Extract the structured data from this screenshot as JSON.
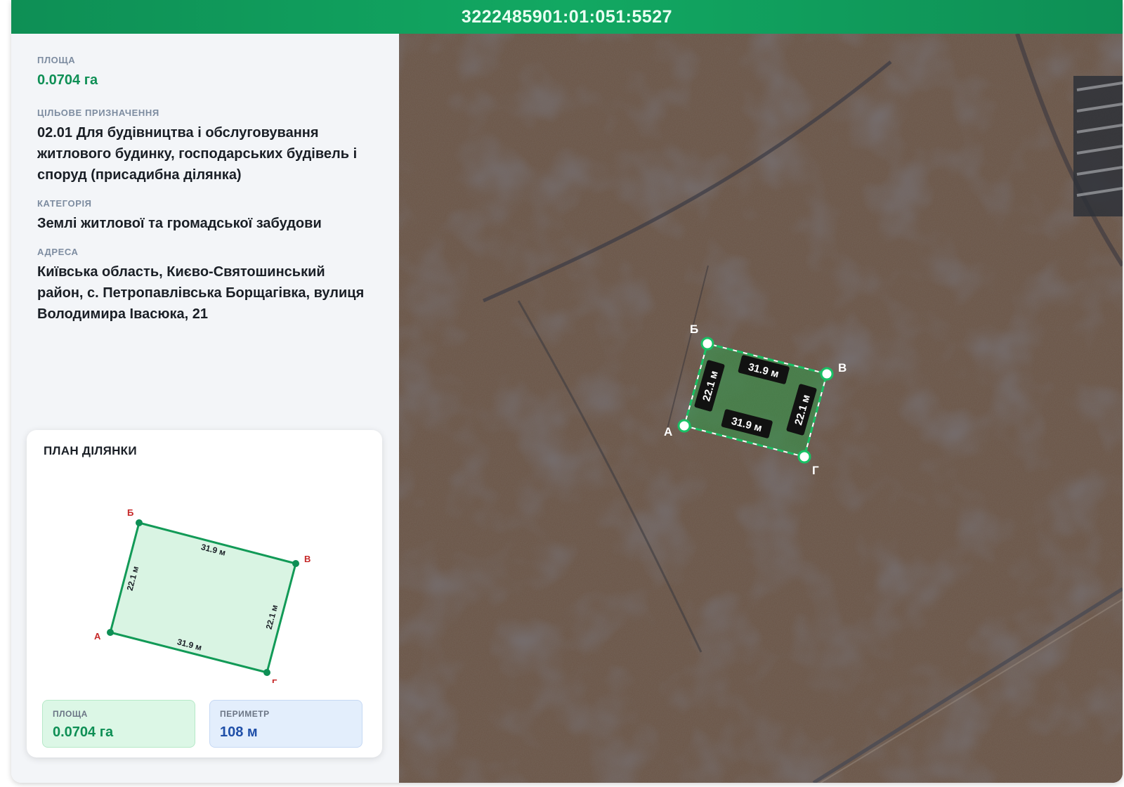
{
  "header": {
    "cadastral_number": "3222485901:01:051:5527"
  },
  "info": {
    "area": {
      "label": "ПЛОЩА",
      "value": "0.0704 га"
    },
    "purpose": {
      "label": "ЦІЛЬОВЕ ПРИЗНАЧЕННЯ",
      "value": "02.01 Для будівництва і обслуговування житлового будинку, господарських будівель і споруд (присадибна ділянка)"
    },
    "category": {
      "label": "КАТЕГОРІЯ",
      "value": "Землі житлової та громадської забудови"
    },
    "address": {
      "label": "АДРЕСА",
      "value": "Київська область, Києво-Святошинський район, с. Петропавлівська Борщагівка, вулиця Володимира Івасюка, 21"
    }
  },
  "plan": {
    "title": "ПЛАН ДІЛЯНКИ",
    "vertices": {
      "a": "А",
      "b": "Б",
      "v": "В",
      "g": "Г"
    },
    "edges": {
      "top": "31.9 м",
      "bottom": "31.9 м",
      "left": "22.1 м",
      "right": "22.1 м"
    },
    "area": {
      "label": "ПЛОЩА",
      "value": "0.0704 га"
    },
    "perimeter": {
      "label": "ПЕРИМЕТР",
      "value": "108 м"
    }
  },
  "map": {
    "vertices": {
      "a": "А",
      "b": "Б",
      "v": "В",
      "g": "Г"
    },
    "edges": {
      "top": "31.9 м",
      "bottom": "31.9 м",
      "left": "22.1 м",
      "right": "22.1 м"
    }
  },
  "colors": {
    "accent": "#0e8f55",
    "perimeter_blue": "#1f4fa8",
    "vertex_red": "#c62828"
  }
}
